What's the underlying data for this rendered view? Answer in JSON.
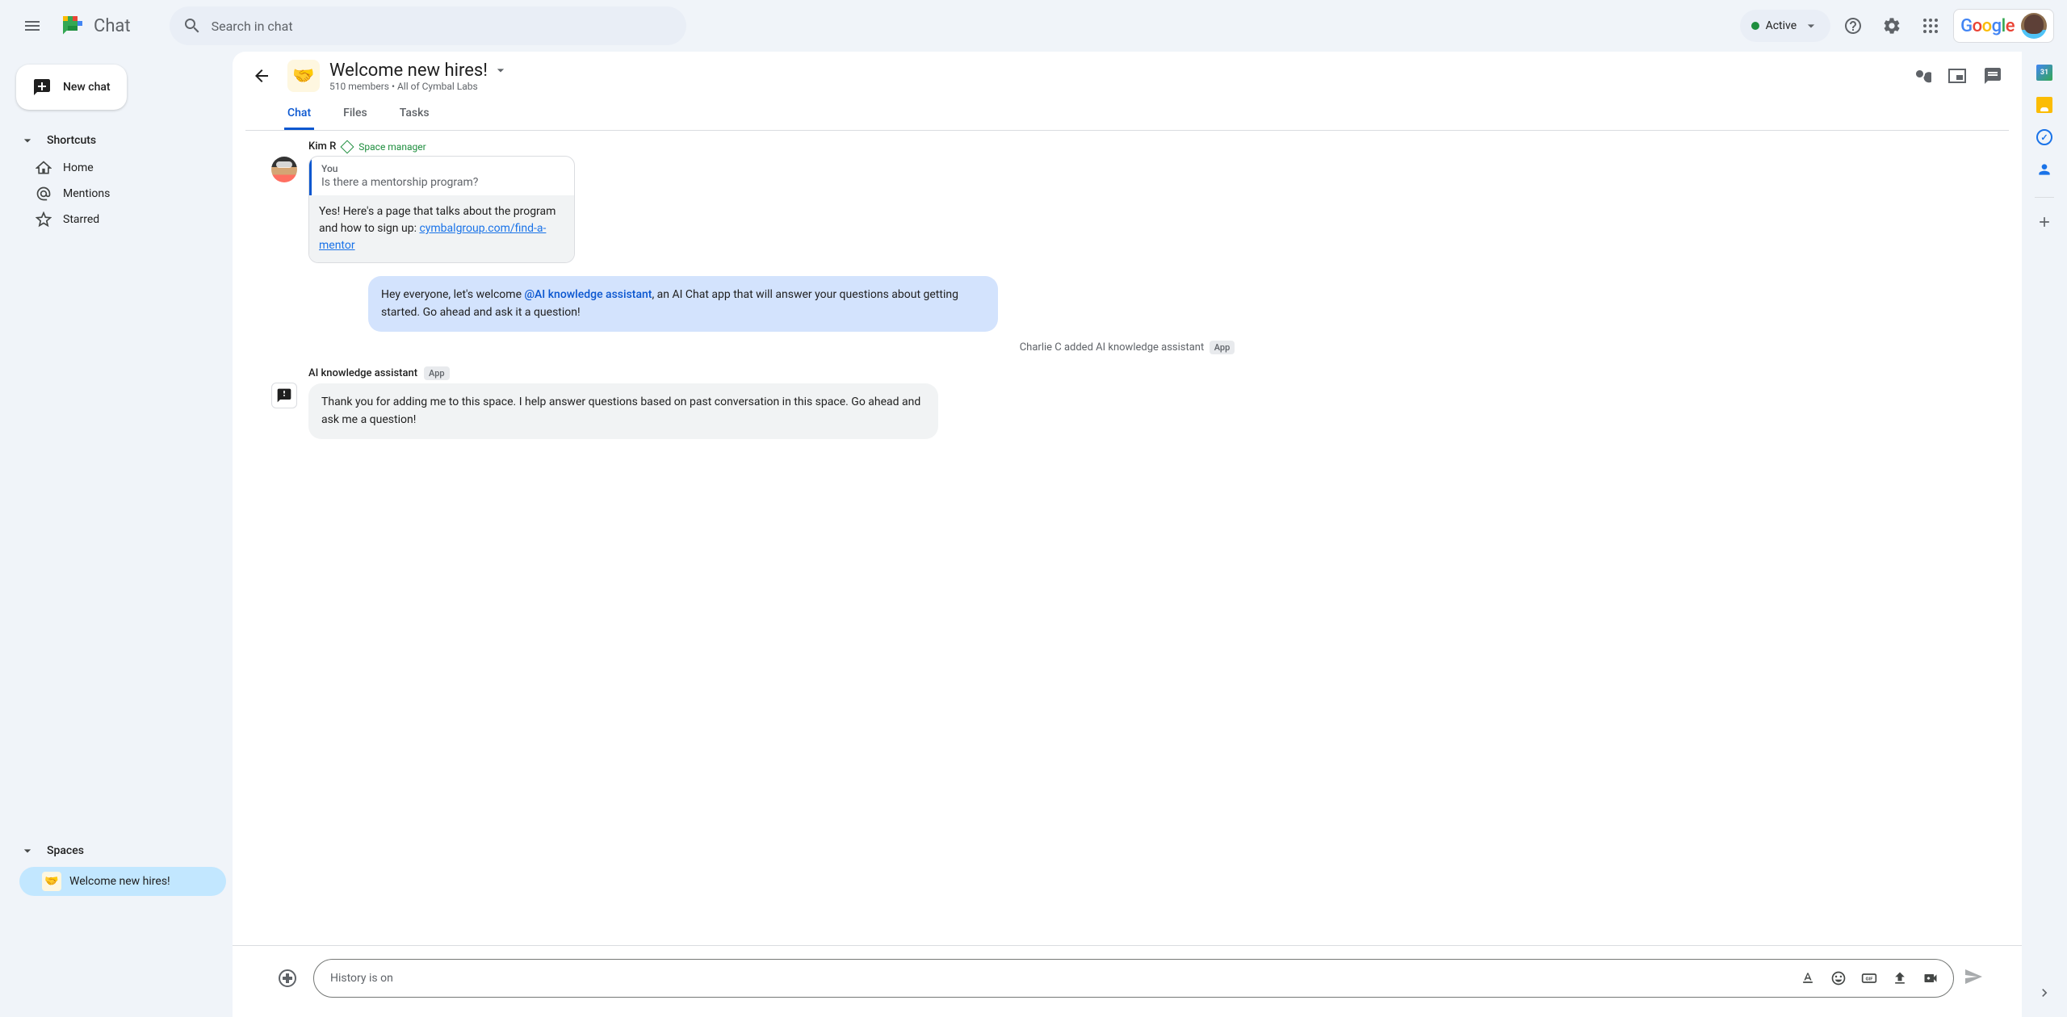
{
  "header": {
    "app_name": "Chat",
    "search_placeholder": "Search in chat",
    "status": "Active"
  },
  "sidebar": {
    "new_chat": "New chat",
    "shortcuts_label": "Shortcuts",
    "shortcuts": [
      {
        "label": "Home"
      },
      {
        "label": "Mentions"
      },
      {
        "label": "Starred"
      }
    ],
    "spaces_label": "Spaces",
    "spaces": [
      {
        "label": "Welcome new hires!",
        "emoji": "🤝"
      }
    ]
  },
  "chat": {
    "title": "Welcome new hires!",
    "emoji": "🤝",
    "subtitle": "510 members  •  All of Cymbal Labs",
    "tabs": [
      {
        "label": "Chat",
        "active": true
      },
      {
        "label": "Files",
        "active": false
      },
      {
        "label": "Tasks",
        "active": false
      }
    ]
  },
  "messages": {
    "kim": {
      "name": "Kim R",
      "role": "Space manager",
      "quote_label": "You",
      "quote_text": "Is there a mentorship program?",
      "reply_text": "Yes! Here's a page that talks about the program and how to sign up: ",
      "reply_link": "cymbalgroup.com/find-a-mentor"
    },
    "announce": {
      "pre": "Hey everyone, let's welcome ",
      "mention": "@AI knowledge assistant",
      "post": ", an AI Chat app that will answer your questions about getting started.  Go ahead and ask it a question!"
    },
    "system": {
      "text": "Charlie C added AI knowledge assistant",
      "badge": "App"
    },
    "bot": {
      "name": "AI knowledge assistant",
      "badge": "App",
      "text": "Thank you for adding me to this space. I help answer questions based on past conversation in this space. Go ahead and ask me a question!"
    }
  },
  "compose": {
    "placeholder": "History is on"
  }
}
